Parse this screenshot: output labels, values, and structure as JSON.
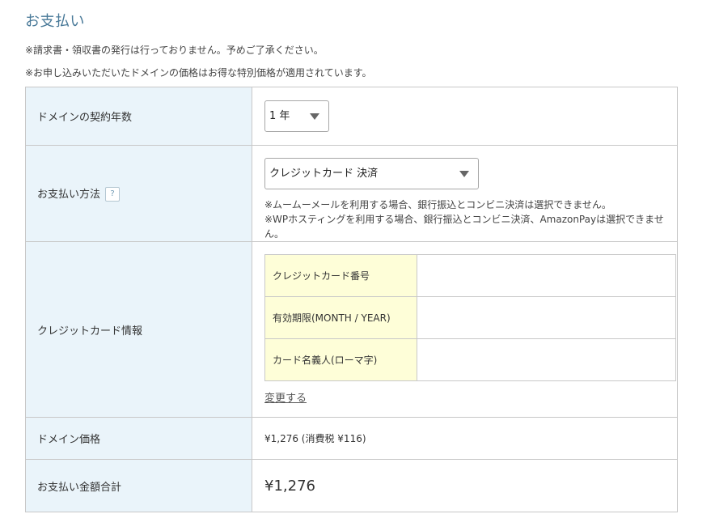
{
  "header": {
    "title": "お支払い",
    "note1": "※請求書・領収書の発行は行っておりません。予めご了承ください。",
    "note2": "※お申し込みいただいたドメインの価格はお得な特別価格が適用されています。"
  },
  "form": {
    "contract_years": {
      "label": "ドメインの契約年数",
      "selected": "1 年"
    },
    "payment_method": {
      "label": "お支払い方法",
      "help_icon": "?",
      "selected": "クレジットカード 決済",
      "note1": "※ムームーメールを利用する場合、銀行振込とコンビニ決済は選択できません。",
      "note2": "※WPホスティングを利用する場合、銀行振込とコンビニ決済、AmazonPayは選択できません。"
    },
    "credit_card": {
      "label": "クレジットカード情報",
      "rows": [
        {
          "label": "クレジットカード番号",
          "value": ""
        },
        {
          "label": "有効期限(MONTH / YEAR)",
          "value": ""
        },
        {
          "label": "カード名義人(ローマ字)",
          "value": ""
        }
      ],
      "change_link": "変更する"
    },
    "domain_price": {
      "label": "ドメイン価格",
      "value": "¥1,276 (消費税 ¥116)"
    },
    "total": {
      "label": "お支払い金額合計",
      "value": "¥1,276"
    }
  }
}
